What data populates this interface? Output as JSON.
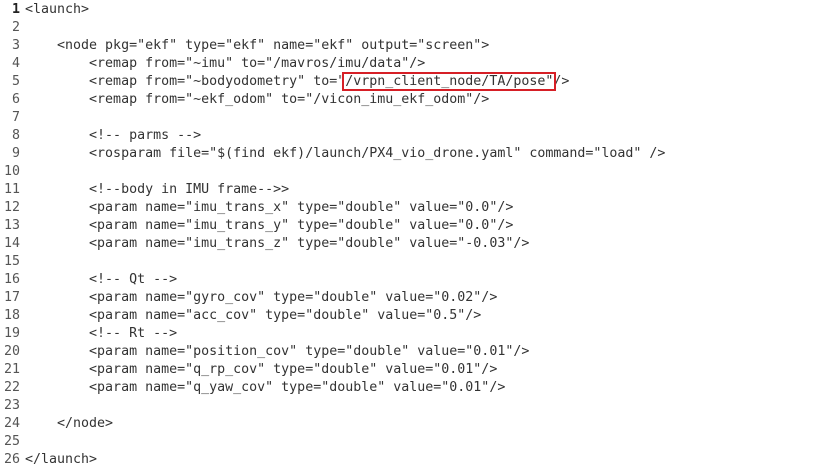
{
  "editor": {
    "lines": [
      {
        "number": "1",
        "current": true,
        "segments": [
          {
            "text": "<launch>"
          }
        ]
      },
      {
        "number": "2",
        "segments": [
          {
            "text": ""
          }
        ]
      },
      {
        "number": "3",
        "segments": [
          {
            "text": "    <node pkg=\"ekf\" type=\"ekf\" name=\"ekf\" output=\"screen\">"
          }
        ]
      },
      {
        "number": "4",
        "segments": [
          {
            "text": "        <remap from=\"~imu\" to=\"/mavros/imu/data\"/>"
          }
        ]
      },
      {
        "number": "5",
        "segments": [
          {
            "text": "        <remap from=\"~bodyodometry\" to=\""
          },
          {
            "text": "/vrpn_client_node/TA/pose\"",
            "highlight": true
          },
          {
            "text": "/>"
          }
        ]
      },
      {
        "number": "6",
        "segments": [
          {
            "text": "        <remap from=\"~ekf_odom\" to=\"/vicon_imu_ekf_odom\"/>"
          }
        ]
      },
      {
        "number": "7",
        "segments": [
          {
            "text": ""
          }
        ]
      },
      {
        "number": "8",
        "segments": [
          {
            "text": "        <!-- parms -->"
          }
        ]
      },
      {
        "number": "9",
        "segments": [
          {
            "text": "        <rosparam file=\"$(find ekf)/launch/PX4_vio_drone.yaml\" command=\"load\" />"
          }
        ]
      },
      {
        "number": "10",
        "segments": [
          {
            "text": ""
          }
        ]
      },
      {
        "number": "11",
        "segments": [
          {
            "text": "        <!--body in IMU frame-->>"
          }
        ]
      },
      {
        "number": "12",
        "segments": [
          {
            "text": "        <param name=\"imu_trans_x\" type=\"double\" value=\"0.0\"/>"
          }
        ]
      },
      {
        "number": "13",
        "segments": [
          {
            "text": "        <param name=\"imu_trans_y\" type=\"double\" value=\"0.0\"/>"
          }
        ]
      },
      {
        "number": "14",
        "segments": [
          {
            "text": "        <param name=\"imu_trans_z\" type=\"double\" value=\"-0.03\"/>"
          }
        ]
      },
      {
        "number": "15",
        "segments": [
          {
            "text": ""
          }
        ]
      },
      {
        "number": "16",
        "segments": [
          {
            "text": "        <!-- Qt -->"
          }
        ]
      },
      {
        "number": "17",
        "segments": [
          {
            "text": "        <param name=\"gyro_cov\" type=\"double\" value=\"0.02\"/>"
          }
        ]
      },
      {
        "number": "18",
        "segments": [
          {
            "text": "        <param name=\"acc_cov\" type=\"double\" value=\"0.5\"/>"
          }
        ]
      },
      {
        "number": "19",
        "segments": [
          {
            "text": "        <!-- Rt -->"
          }
        ]
      },
      {
        "number": "20",
        "segments": [
          {
            "text": "        <param name=\"position_cov\" type=\"double\" value=\"0.01\"/>"
          }
        ]
      },
      {
        "number": "21",
        "segments": [
          {
            "text": "        <param name=\"q_rp_cov\" type=\"double\" value=\"0.01\"/>"
          }
        ]
      },
      {
        "number": "22",
        "segments": [
          {
            "text": "        <param name=\"q_yaw_cov\" type=\"double\" value=\"0.01\"/>"
          }
        ]
      },
      {
        "number": "23",
        "segments": [
          {
            "text": ""
          }
        ]
      },
      {
        "number": "24",
        "segments": [
          {
            "text": "    </node>"
          }
        ]
      },
      {
        "number": "25",
        "segments": [
          {
            "text": ""
          }
        ]
      },
      {
        "number": "26",
        "segments": [
          {
            "text": "</launch>"
          }
        ]
      }
    ]
  },
  "colors": {
    "highlight_box": "#d61f26",
    "text": "#333333",
    "line_number": "#555555"
  }
}
